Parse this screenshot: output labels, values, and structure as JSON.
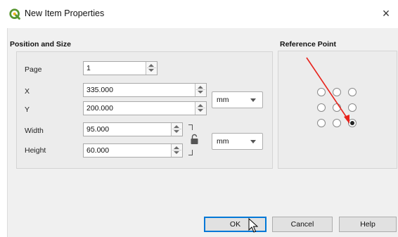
{
  "window": {
    "title": "New Item Properties",
    "close_glyph": "×"
  },
  "position_size": {
    "section_title": "Position and Size",
    "page": {
      "label": "Page",
      "value": "1"
    },
    "x": {
      "label": "X",
      "value": "335.000"
    },
    "y": {
      "label": "Y",
      "value": "200.000"
    },
    "width": {
      "label": "Width",
      "value": "95.000"
    },
    "height": {
      "label": "Height",
      "value": "60.000"
    },
    "position_unit": "mm",
    "size_unit": "mm"
  },
  "reference_point": {
    "section_title": "Reference Point",
    "selected": "bottom-right"
  },
  "buttons": {
    "ok": "OK",
    "cancel": "Cancel",
    "help": "Help"
  },
  "colors": {
    "accent": "#0078d7",
    "annotation_arrow": "#e8221b",
    "brand": "#589632"
  }
}
